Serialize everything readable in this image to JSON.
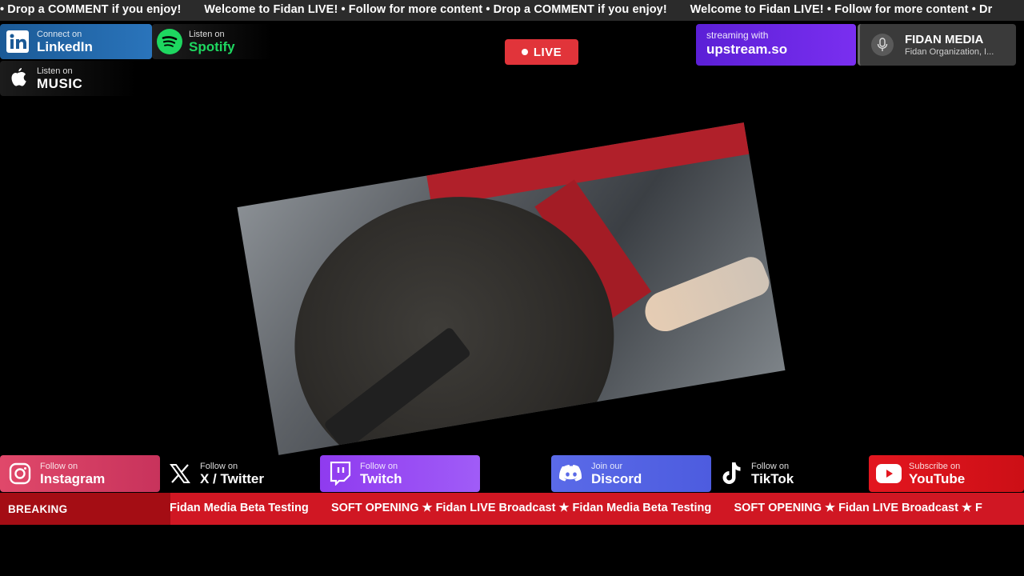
{
  "top_ticker": {
    "text": "• Drop a COMMENT if you enjoy!       Welcome to Fidan LIVE! • Follow for more content • Drop a COMMENT if you enjoy!       Welcome to Fidan LIVE! • Follow for more content • Dr"
  },
  "social_top": {
    "linkedin": {
      "small": "Connect on",
      "big": "LinkedIn",
      "icon": "linkedin-icon"
    },
    "spotify": {
      "small": "Listen on",
      "big": "Spotify",
      "icon": "spotify-icon"
    },
    "music": {
      "small": "Listen on",
      "big": "MUSIC",
      "icon": "apple-icon"
    }
  },
  "live": {
    "label": "LIVE",
    "color": "#e1343a"
  },
  "upstream": {
    "line1": "streaming with",
    "line2": "upstream.so"
  },
  "fidan": {
    "title": "FIDAN MEDIA",
    "subtitle": "Fidan Organization, I...",
    "icon": "microphone-icon"
  },
  "social_bottom": {
    "instagram": {
      "small": "Follow on",
      "big": "Instagram",
      "icon": "instagram-icon"
    },
    "twitter": {
      "small": "Follow on",
      "big": "X / Twitter",
      "icon": "x-icon"
    },
    "twitch": {
      "small": "Follow on",
      "big": "Twitch",
      "icon": "twitch-icon"
    },
    "discord": {
      "small": "Join our",
      "big": "Discord",
      "icon": "discord-icon"
    },
    "tiktok": {
      "small": "Follow on",
      "big": "TikTok",
      "icon": "tiktok-icon"
    },
    "youtube": {
      "small": "Subscribe on",
      "big": "YouTube",
      "icon": "youtube-icon"
    }
  },
  "breaking": {
    "label": "BREAKING",
    "text": "Fidan Media Beta Testing       SOFT OPENING ★ Fidan LIVE Broadcast ★ Fidan Media Beta Testing       SOFT OPENING ★ Fidan LIVE Broadcast ★ F"
  }
}
